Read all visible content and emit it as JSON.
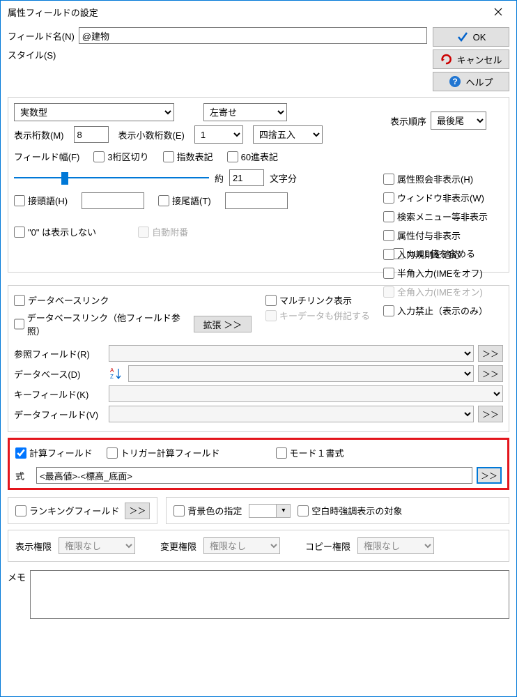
{
  "titlebar": {
    "title": "属性フィールドの設定"
  },
  "buttons": {
    "ok": "OK",
    "cancel": "キャンセル",
    "help": "ヘルプ"
  },
  "field": {
    "name_label": "フィールド名(N)",
    "name_value": "@建物",
    "style_label": "スタイル(S)",
    "type": "実数型",
    "align": "左寄せ",
    "display_digits_label": "表示桁数(M)",
    "display_digits": "8",
    "decimal_digits_label": "表示小数桁数(E)",
    "decimal_digits": "1",
    "rounding": "四捨五入",
    "field_width_label": "フィールド幅(F)",
    "approx": "約",
    "chars": "21",
    "chars_suffix": "文字分",
    "sep3": "3桁区切り",
    "exp": "指数表記",
    "base60": "60進表記",
    "prefix_label": "接頭語(H)",
    "suffix_label": "接尾語(T)",
    "hide_zero": "\"0\" は表示しない",
    "auto_number": "自動附番",
    "include_null": "NULL値を含める"
  },
  "display_order": {
    "label": "表示順序",
    "value": "最後尾"
  },
  "options": {
    "hide_attr_query": "属性照会非表示(H)",
    "hide_window": "ウィンドウ非表示(W)",
    "hide_search_menu": "検索メニュー等非表示",
    "hide_attr_assign": "属性付与非表示",
    "apply_input_rule": "入力規則を適応",
    "half_width": "半角入力(IMEをオフ)",
    "full_width": "全角入力(IMEをオン)",
    "input_disabled": "入力禁止（表示のみ）"
  },
  "dblink": {
    "db_link": "データベースリンク",
    "db_link_other": "データベースリンク（他フィールド参照）",
    "multi_link": "マルチリンク表示",
    "key_data_also": "キーデータも併記する",
    "expand": "拡張  ＞＞",
    "ref_field": "参照フィールド(R)",
    "database": "データベース(D)",
    "key_field": "キーフィールド(K)",
    "data_field": "データフィールド(V)",
    "more": "＞＞"
  },
  "calc": {
    "calc_field": "計算フィールド",
    "trigger_calc": "トリガー計算フィールド",
    "mode1": "モード１書式",
    "formula_label": "式",
    "formula": "<最高値>-<標高_底面>",
    "more": "＞＞"
  },
  "ranking": {
    "label": "ランキングフィールド",
    "more": "＞＞",
    "bgcolor": "背景色の指定",
    "blank_emphasis": "空白時強調表示の対象"
  },
  "perms": {
    "display": "表示権限",
    "change": "変更権限",
    "copy": "コピー権限",
    "none": "権限なし"
  },
  "memo": {
    "label": "メモ"
  }
}
